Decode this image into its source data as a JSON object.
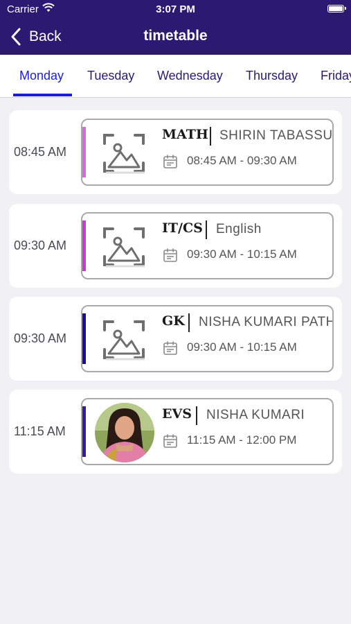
{
  "status_bar": {
    "carrier": "Carrier",
    "time": "3:07 PM"
  },
  "nav": {
    "back_label": "Back",
    "title": "timetable"
  },
  "tabs": [
    {
      "label": "Monday",
      "active": true
    },
    {
      "label": "Tuesday",
      "active": false
    },
    {
      "label": "Wednesday",
      "active": false
    },
    {
      "label": "Thursday",
      "active": false
    },
    {
      "label": "Friday",
      "active": false
    }
  ],
  "periods": [
    {
      "time": "08:45 AM",
      "subject": "MATH",
      "teacher": "SHIRIN  TABASSUM",
      "range": "08:45 AM - 09:30 AM",
      "accent": "#d46bd8",
      "image": "image-placeholder-icon"
    },
    {
      "time": "09:30 AM",
      "subject": "IT/CS",
      "teacher": "English",
      "range": "09:30 AM - 10:15 AM",
      "accent": "#c93ad0",
      "image": "image-placeholder-icon"
    },
    {
      "time": "09:30 AM",
      "subject": "GK",
      "teacher": "NISHA KUMARI PATHAK",
      "range": "09:30 AM - 10:15 AM",
      "accent": "#1a0aa0",
      "image": "image-placeholder-icon"
    },
    {
      "time": "11:15 AM",
      "subject": "EVS",
      "teacher": "NISHA  KUMARI",
      "range": "11:15 AM - 12:00 PM",
      "accent": "#3a1a9a",
      "image": "teacher-photo"
    }
  ],
  "colors": {
    "header": "#2a1a72",
    "tab_active": "#1a1ed4",
    "background": "#f0f0f5"
  }
}
